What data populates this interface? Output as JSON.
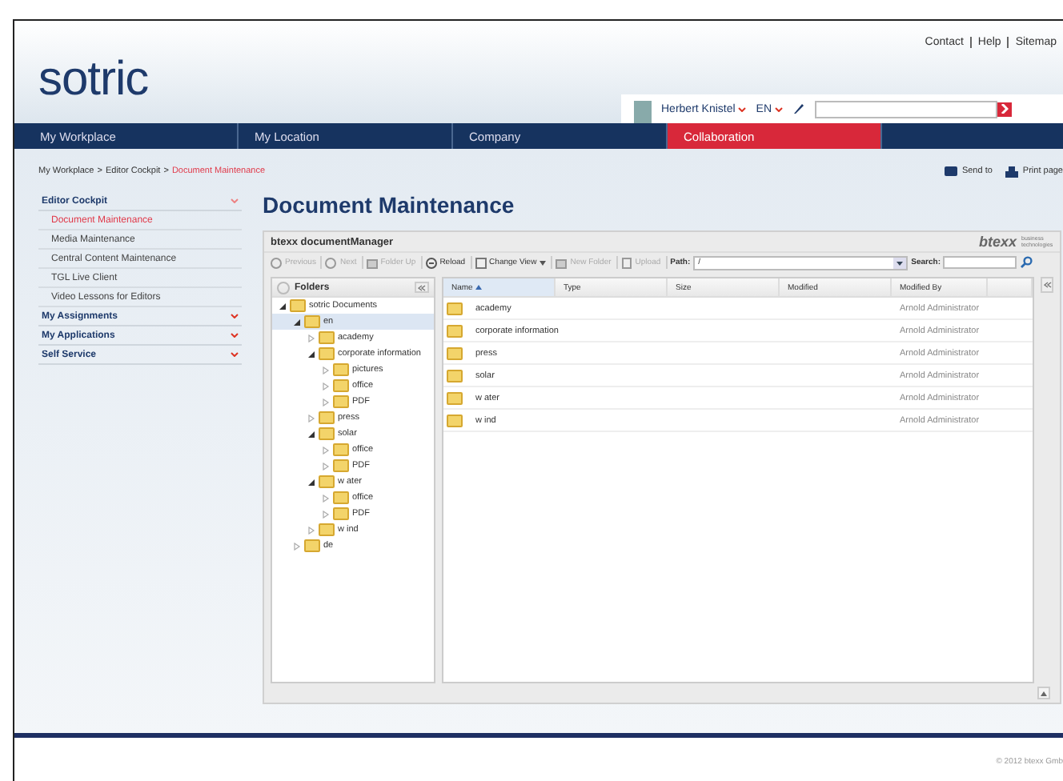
{
  "top_links": [
    "Contact",
    "Help",
    "Sitemap"
  ],
  "logo": "sotric",
  "user": {
    "name": "Herbert Knistel",
    "language": "EN"
  },
  "nav": [
    {
      "label": "My Workplace",
      "selected": false
    },
    {
      "label": "My Location",
      "selected": false
    },
    {
      "label": "Company",
      "selected": false
    },
    {
      "label": "Collaboration",
      "selected": true
    }
  ],
  "breadcrumb": {
    "separator": ">",
    "items": [
      {
        "label": "My Workplace",
        "current": false
      },
      {
        "label": "Editor Cockpit",
        "current": false
      },
      {
        "label": "Document Maintenance",
        "current": true
      }
    ]
  },
  "page_actions": [
    {
      "label": "Send to",
      "kind": "mail"
    },
    {
      "label": "Print page",
      "kind": "print"
    }
  ],
  "sidebar": [
    {
      "label": "Editor Cockpit",
      "expanded": true,
      "items": [
        {
          "label": "Document Maintenance",
          "selected": true
        },
        {
          "label": "Media Maintenance",
          "selected": false
        },
        {
          "label": "Central Content Maintenance",
          "selected": false
        },
        {
          "label": "TGL Live Client",
          "selected": false
        },
        {
          "label": "Video Lessons for Editors",
          "selected": false
        }
      ]
    },
    {
      "label": "My Assignments",
      "expanded": false
    },
    {
      "label": "My Applications",
      "expanded": false
    },
    {
      "label": "Self Service",
      "expanded": false
    }
  ],
  "page_title": "Document Maintenance",
  "manager": {
    "title": "btexx documentManager",
    "brand": "btexx",
    "brand_tagline": "business technologies",
    "toolbar": [
      {
        "label": "Previous",
        "kind": "circle",
        "disabled": true
      },
      {
        "label": "Next",
        "kind": "circle",
        "disabled": true
      },
      {
        "label": "Folder Up",
        "kind": "folder",
        "disabled": true
      },
      {
        "label": "Reload",
        "kind": "reload",
        "disabled": false
      },
      {
        "label": "Change View",
        "kind": "view",
        "disabled": false
      },
      {
        "label": "New Folder",
        "kind": "folder",
        "disabled": true
      },
      {
        "label": "Upload",
        "kind": "upload",
        "disabled": true
      }
    ],
    "path_label": "Path:",
    "path_value": "/",
    "search_label": "Search:",
    "folders_title": "Folders",
    "tree": [
      {
        "label": "sotric Documents",
        "expanded": true,
        "selected": false,
        "children": [
          {
            "label": "en",
            "expanded": true,
            "selected": true,
            "children": [
              {
                "label": "academy",
                "expanded": false,
                "selected": false
              },
              {
                "label": "corporate information",
                "expanded": true,
                "selected": false,
                "children": [
                  {
                    "label": "pictures",
                    "expanded": false,
                    "selected": false
                  },
                  {
                    "label": "office",
                    "expanded": false,
                    "selected": false
                  },
                  {
                    "label": "PDF",
                    "expanded": false,
                    "selected": false
                  }
                ]
              },
              {
                "label": "press",
                "expanded": false,
                "selected": false
              },
              {
                "label": "solar",
                "expanded": true,
                "selected": false,
                "children": [
                  {
                    "label": "office",
                    "expanded": false,
                    "selected": false
                  },
                  {
                    "label": "PDF",
                    "expanded": false,
                    "selected": false
                  }
                ]
              },
              {
                "label": "w ater",
                "expanded": true,
                "selected": false,
                "children": [
                  {
                    "label": "office",
                    "expanded": false,
                    "selected": false
                  },
                  {
                    "label": "PDF",
                    "expanded": false,
                    "selected": false
                  }
                ]
              },
              {
                "label": "w ind",
                "expanded": false,
                "selected": false
              }
            ]
          },
          {
            "label": "de",
            "expanded": false,
            "selected": false
          }
        ]
      }
    ],
    "columns": [
      {
        "label": "Name",
        "sorted": true
      },
      {
        "label": "Type",
        "sorted": false
      },
      {
        "label": "Size",
        "sorted": false
      },
      {
        "label": "Modified",
        "sorted": false
      },
      {
        "label": "Modified By",
        "sorted": false
      }
    ],
    "rows": [
      {
        "name": "academy",
        "modified_by": "Arnold Administrator"
      },
      {
        "name": "corporate information",
        "modified_by": "Arnold Administrator"
      },
      {
        "name": "press",
        "modified_by": "Arnold Administrator"
      },
      {
        "name": "solar",
        "modified_by": "Arnold Administrator"
      },
      {
        "name": "w ater",
        "modified_by": "Arnold Administrator"
      },
      {
        "name": "w ind",
        "modified_by": "Arnold Administrator"
      }
    ]
  },
  "copyright": "© 2012 btexx Gmb"
}
